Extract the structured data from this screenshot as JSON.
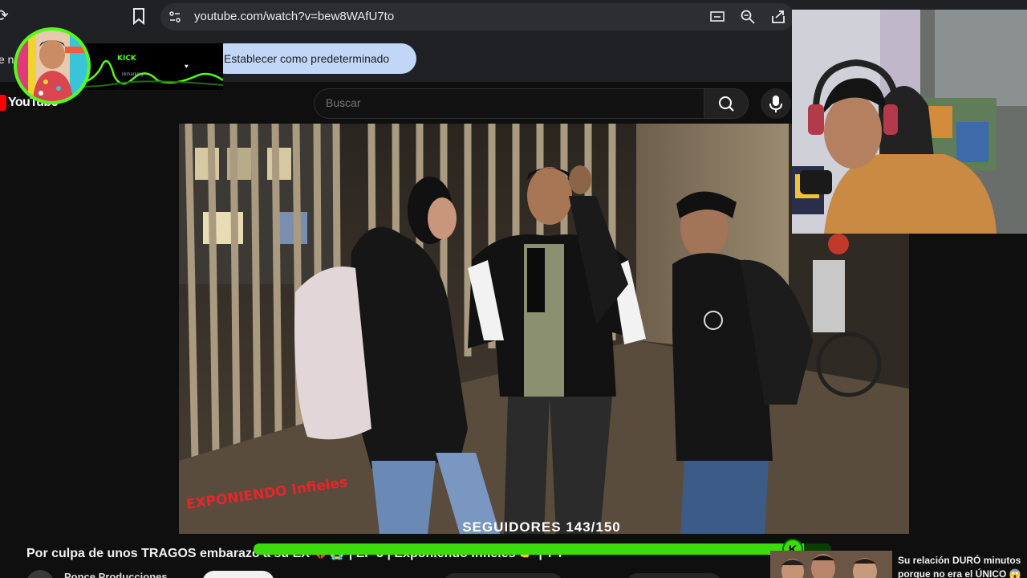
{
  "browser": {
    "url": "youtube.com/watch?v=bew8WAfU7to"
  },
  "infobar": {
    "partial_text": "e n",
    "button_label": "Establecer como predeterminado"
  },
  "kick_overlay": {
    "logo": "KICK",
    "username": "lilcharking"
  },
  "masthead": {
    "logo_text": "YouTube",
    "search_placeholder": "Buscar"
  },
  "video": {
    "watermark": "EXPONIENDO Infieles",
    "follower_counter": "SEGUIDORES 143/150",
    "progress_fraction": 0.953
  },
  "video_info": {
    "title": "Por culpa de unos TRAGOS embarazó a su EX 💔😭 | EP 3 | Exponiendo Infieles 👉 | T 7",
    "channel_name": "Ponce Producciones"
  },
  "related": {
    "title": "Su relación DURÓ minutos porque no era el ÚNICO 😱"
  },
  "colors": {
    "kick_green": "#53fc18",
    "progress_green": "#3cdc0c",
    "youtube_red": "#ff0000",
    "default_button_bg": "#c2d6f8"
  }
}
